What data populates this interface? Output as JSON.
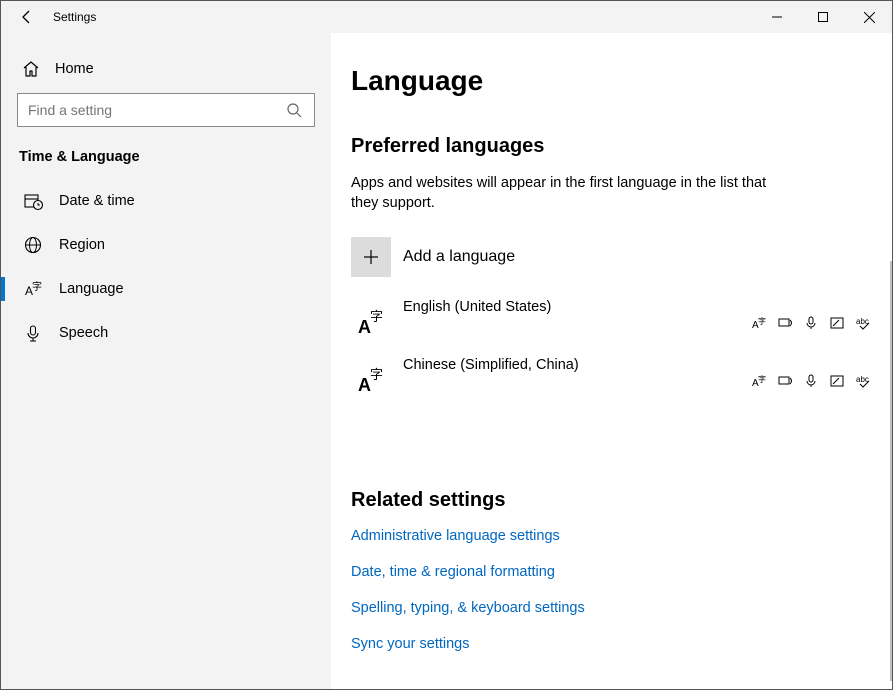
{
  "window": {
    "title": "Settings"
  },
  "sidebar": {
    "home": "Home",
    "search_placeholder": "Find a setting",
    "group": "Time & Language",
    "items": [
      {
        "label": "Date & time"
      },
      {
        "label": "Region"
      },
      {
        "label": "Language"
      },
      {
        "label": "Speech"
      }
    ]
  },
  "main": {
    "heading": "Language",
    "preferred_heading": "Preferred languages",
    "preferred_desc": "Apps and websites will appear in the first language in the list that they support.",
    "add_label": "Add a language",
    "languages": [
      {
        "name": "English (United States)"
      },
      {
        "name": "Chinese (Simplified, China)"
      }
    ],
    "related_heading": "Related settings",
    "links": [
      "Administrative language settings",
      "Date, time & regional formatting",
      "Spelling, typing, & keyboard settings",
      "Sync your settings"
    ]
  }
}
